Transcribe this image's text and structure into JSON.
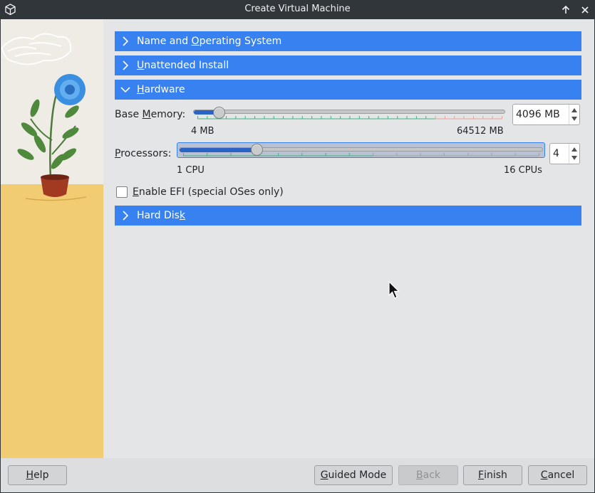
{
  "window": {
    "title": "Create Virtual Machine"
  },
  "sections": {
    "name_os": {
      "pre": "Name and ",
      "accel": "O",
      "post": "perating System"
    },
    "unattended": {
      "pre": "",
      "accel": "U",
      "post": "nattended Install"
    },
    "hardware": {
      "pre": "",
      "accel": "H",
      "post": "ardware"
    },
    "hard_disk": {
      "pre": "Hard Dis",
      "accel": "k",
      "post": ""
    }
  },
  "hardware": {
    "memory": {
      "label_pre": "Base ",
      "label_accel": "M",
      "label_post": "emory:",
      "min_label": "4 MB",
      "max_label": "64512 MB",
      "value_text": "4096 MB",
      "value": 4096,
      "min": 4,
      "max": 64512
    },
    "processors": {
      "label_pre": "",
      "label_accel": "P",
      "label_post": "rocessors:",
      "min_label": "1 CPU",
      "max_label": "16 CPUs",
      "value_text": "4",
      "value": 4,
      "min": 1,
      "max": 16
    },
    "efi": {
      "label_pre": "",
      "label_accel": "E",
      "label_post": "nable EFI (special OSes only)",
      "checked": false
    }
  },
  "buttons": {
    "help": {
      "pre": "",
      "accel": "H",
      "post": "elp"
    },
    "guided": {
      "pre": "",
      "accel": "G",
      "post": "uided Mode"
    },
    "back": {
      "pre": "",
      "accel": "B",
      "post": "ack"
    },
    "finish": {
      "pre": "",
      "accel": "F",
      "post": "inish"
    },
    "cancel": {
      "pre": "",
      "accel": "C",
      "post": "ancel"
    }
  },
  "colors": {
    "accent": "#3781f0",
    "titlebar": "#31363b",
    "slider_fill": "#2b62c6"
  }
}
